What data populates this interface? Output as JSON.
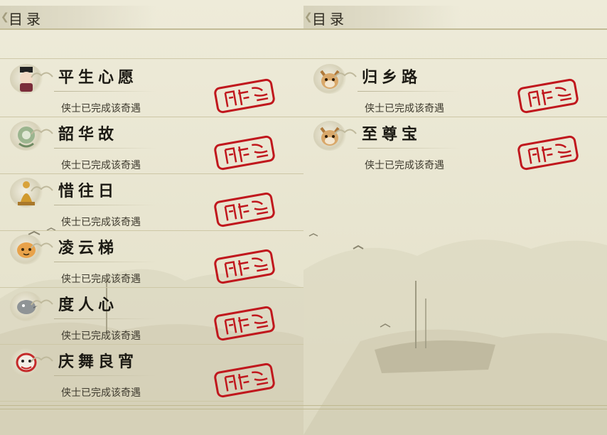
{
  "panels": [
    {
      "header": "目录",
      "entries": [
        {
          "title": "平生心愿",
          "status": "侠士已完成该奇遇",
          "icon": "scholar-portrait-icon"
        },
        {
          "title": "韶华故",
          "status": "侠士已完成该奇遇",
          "icon": "jade-ornament-icon"
        },
        {
          "title": "惜往日",
          "status": "侠士已完成该奇遇",
          "icon": "golden-buddha-icon"
        },
        {
          "title": "凌云梯",
          "status": "侠士已完成该奇遇",
          "icon": "orange-cat-icon"
        },
        {
          "title": "度人心",
          "status": "侠士已完成该奇遇",
          "icon": "grey-bird-icon"
        },
        {
          "title": "庆舞良宵",
          "status": "侠士已完成该奇遇",
          "icon": "lion-dance-icon"
        }
      ]
    },
    {
      "header": "目录",
      "entries": [
        {
          "title": "归乡路",
          "status": "侠士已完成该奇遇",
          "icon": "cat-portrait-icon"
        },
        {
          "title": "至尊宝",
          "status": "侠士已完成该奇遇",
          "icon": "cat-portrait-icon"
        }
      ]
    }
  ],
  "colors": {
    "stamp": "#c0171d",
    "parchment": "#e9e6d3",
    "rule": "#cdc7a6"
  }
}
